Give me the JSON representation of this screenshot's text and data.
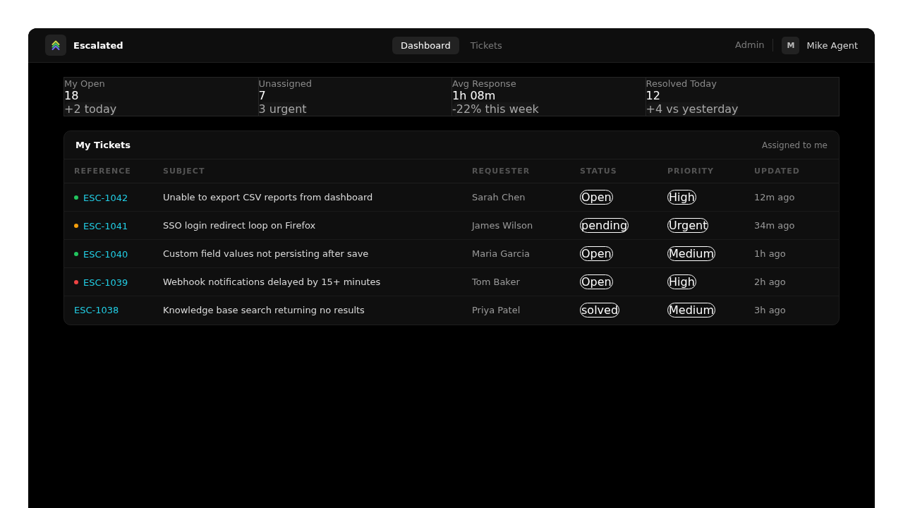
{
  "app": {
    "name": "Escalated"
  },
  "nav": [
    {
      "label": "Dashboard",
      "selected": true
    },
    {
      "label": "Tickets",
      "selected": false
    }
  ],
  "user": {
    "admin_link": "Admin",
    "initial": "M",
    "name": "Mike Agent"
  },
  "stats": [
    {
      "label": "My Open",
      "value": "18",
      "note": "+2 today"
    },
    {
      "label": "Unassigned",
      "value": "7",
      "note": "3 urgent"
    },
    {
      "label": "Avg Response",
      "value": "1h 08m",
      "note": "-22% this week"
    },
    {
      "label": "Resolved Today",
      "value": "12",
      "note": "+4 vs yesterday"
    }
  ],
  "tickets": {
    "title": "My Tickets",
    "filter": "Assigned to me",
    "columns": [
      "REFERENCE",
      "SUBJECT",
      "REQUESTER",
      "STATUS",
      "PRIORITY",
      "UPDATED"
    ],
    "rows": [
      {
        "color": "#22c55e",
        "reference": "ESC-1042",
        "subject": "Unable to export CSV reports from dashboard",
        "requester": "Sarah Chen",
        "status": "Open",
        "priority": "High",
        "updated": "12m ago"
      },
      {
        "color": "#f59e0b",
        "reference": "ESC-1041",
        "subject": "SSO login redirect loop on Firefox",
        "requester": "James Wilson",
        "status": "pending",
        "priority": "Urgent",
        "updated": "34m ago"
      },
      {
        "color": "#22c55e",
        "reference": "ESC-1040",
        "subject": "Custom field values not persisting after save",
        "requester": "Maria Garcia",
        "status": "Open",
        "priority": "Medium",
        "updated": "1h ago"
      },
      {
        "color": "#ef4444",
        "reference": "ESC-1039",
        "subject": "Webhook notifications delayed by 15+ minutes",
        "requester": "Tom Baker",
        "status": "Open",
        "priority": "High",
        "updated": "2h ago"
      },
      {
        "reference": "ESC-1038",
        "subject": "Knowledge base search returning no results",
        "requester": "Priya Patel",
        "status": "solved",
        "priority": "Medium",
        "updated": "3h ago"
      }
    ]
  }
}
